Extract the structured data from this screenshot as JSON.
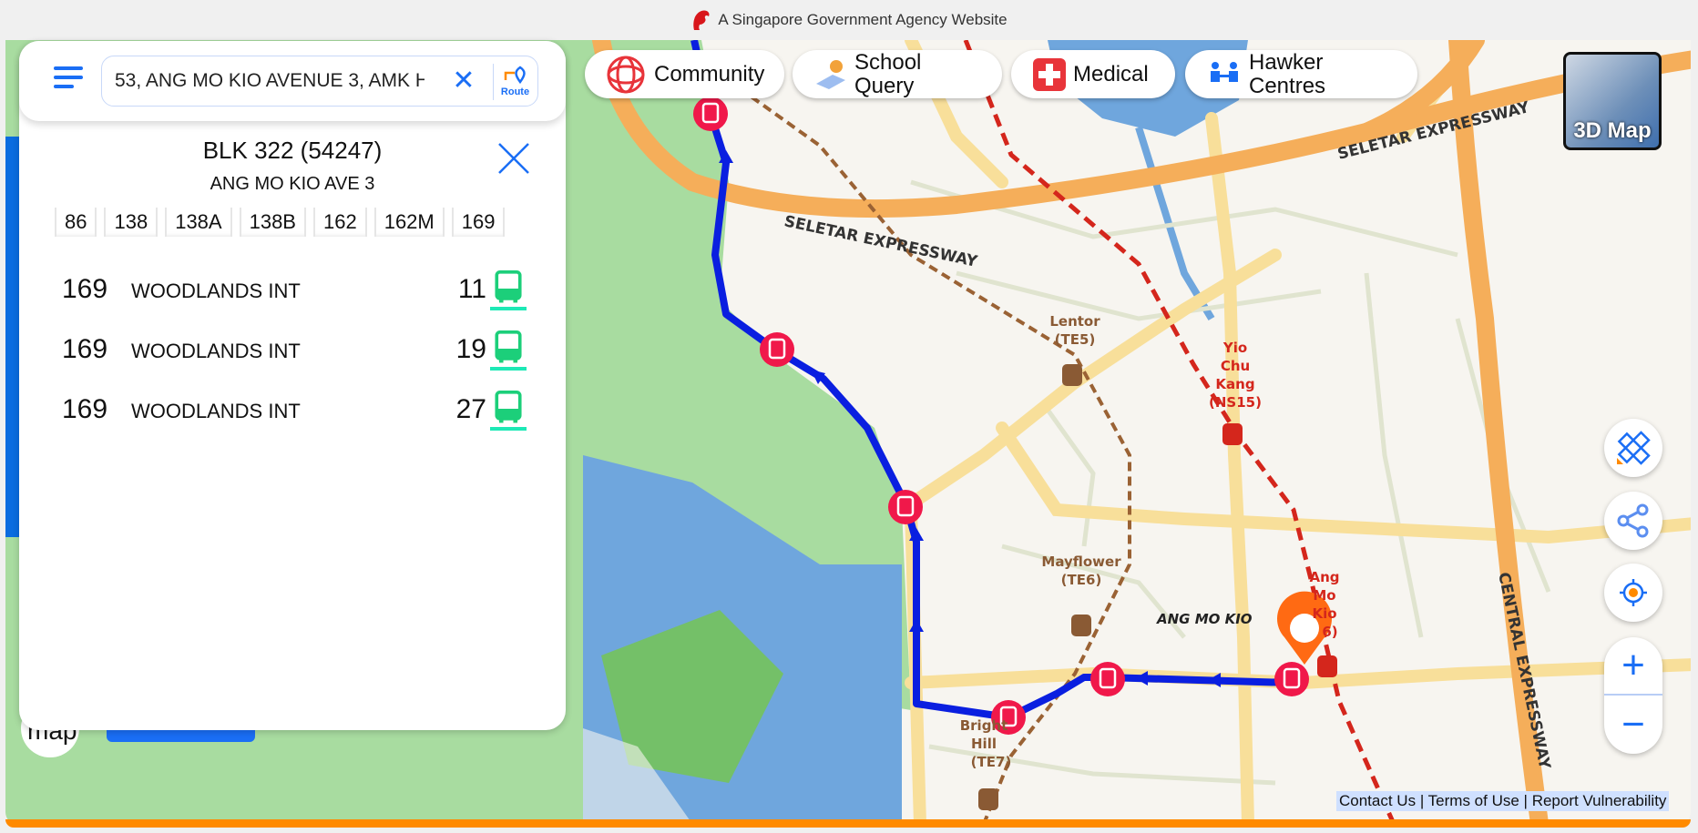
{
  "gov_banner": {
    "text": "A Singapore Government Agency Website",
    "icon": "lion-head-icon"
  },
  "search": {
    "value": "53, ANG MO KIO AVENUE 3, AMK H",
    "route_label": "Route"
  },
  "bus_stop": {
    "title": "BLK 322 (54247)",
    "road": "ANG MO KIO AVE 3",
    "services": [
      "86",
      "138",
      "138A",
      "138B",
      "162",
      "162M",
      "169"
    ],
    "arrivals": [
      {
        "service": "169",
        "destination": "WOODLANDS INT",
        "minutes": "11"
      },
      {
        "service": "169",
        "destination": "WOODLANDS INT",
        "minutes": "19"
      },
      {
        "service": "169",
        "destination": "WOODLANDS INT",
        "minutes": "27"
      }
    ]
  },
  "categories": [
    {
      "label": "Community",
      "icon": "community-icon"
    },
    {
      "label": "School Query",
      "icon": "school-icon"
    },
    {
      "label": "Medical",
      "icon": "medical-cross-icon"
    },
    {
      "label": "Hawker Centres",
      "icon": "hawker-icon"
    }
  ],
  "map_3d_label": "3D Map",
  "map_labels": {
    "seletar1": "SELETAR EXPRESSWAY",
    "seletar2": "SELETAR EXPRESSWAY",
    "central": "CENTRAL EXPRESSWAY",
    "lentor": "Lentor",
    "lentor_code": "(TE5)",
    "ycк1": "Yio",
    "yck2": "Chu",
    "yck3": "Kang",
    "yck_code": "(NS15)",
    "mayflower": "Mayflower",
    "mayflower_code": "(TE6)",
    "amk_town": "ANG MO KIO",
    "amk1": "Ang",
    "amk2": "Mo",
    "amk3": "Kio",
    "amk_code": "6)",
    "bright1": "Bright",
    "bright2": "Hill",
    "bright_code": "(TE7)",
    "logo": "map"
  },
  "footer": {
    "contact": "Contact Us",
    "terms": "Terms of Use",
    "vuln": "Report Vulnerability",
    "sep": "|"
  },
  "colors": {
    "accent": "#1a6ef5",
    "route": "#0a1fe0",
    "bus_stop": "#f0184a",
    "arrival_icon": "#1ccf7a",
    "pin": "#ff6a13",
    "footer_bar": "#ff8a00"
  }
}
